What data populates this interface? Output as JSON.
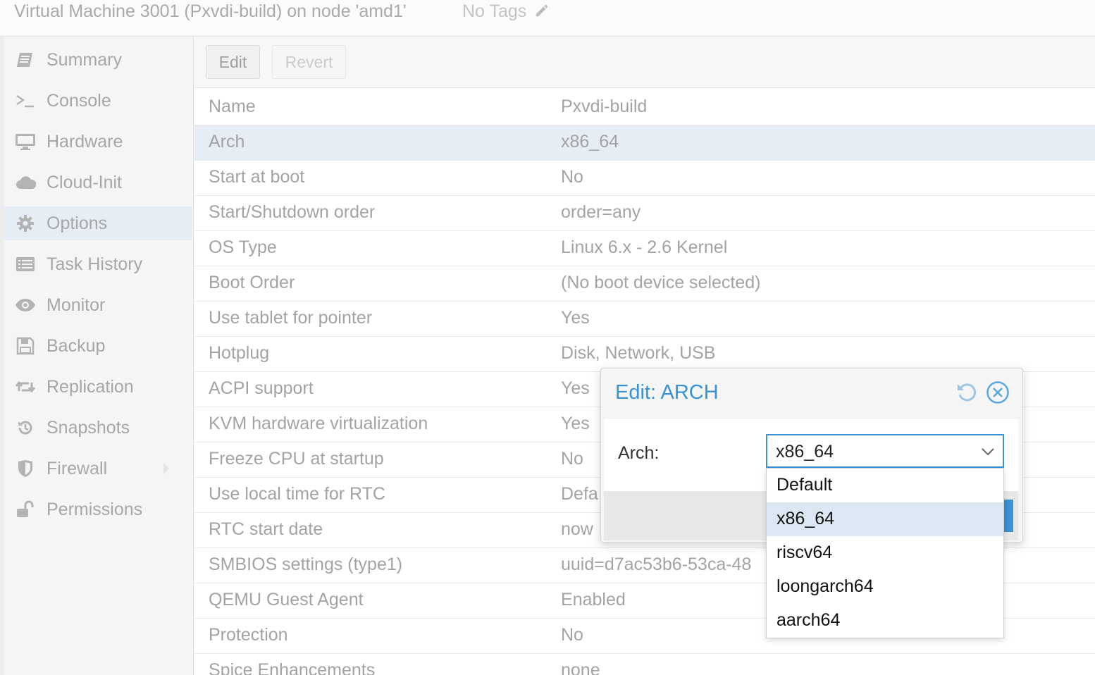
{
  "header": {
    "title": "Virtual Machine 3001 (Pxvdi-build) on node 'amd1'",
    "tags": "No Tags"
  },
  "sidebar": {
    "items": [
      {
        "label": "Summary",
        "icon": "book-icon"
      },
      {
        "label": "Console",
        "icon": "terminal-icon"
      },
      {
        "label": "Hardware",
        "icon": "desktop-icon"
      },
      {
        "label": "Cloud-Init",
        "icon": "cloud-icon"
      },
      {
        "label": "Options",
        "icon": "gear-icon",
        "active": true
      },
      {
        "label": "Task History",
        "icon": "list-icon"
      },
      {
        "label": "Monitor",
        "icon": "eye-icon"
      },
      {
        "label": "Backup",
        "icon": "floppy-icon"
      },
      {
        "label": "Replication",
        "icon": "retweet-icon"
      },
      {
        "label": "Snapshots",
        "icon": "history-icon"
      },
      {
        "label": "Firewall",
        "icon": "shield-icon"
      },
      {
        "label": "Permissions",
        "icon": "unlock-icon"
      }
    ]
  },
  "toolbar": {
    "edit_label": "Edit",
    "revert_label": "Revert"
  },
  "options": {
    "rows": [
      {
        "key": "Name",
        "value": "Pxvdi-build"
      },
      {
        "key": "Arch",
        "value": "x86_64",
        "selected": true
      },
      {
        "key": "Start at boot",
        "value": "No"
      },
      {
        "key": "Start/Shutdown order",
        "value": "order=any"
      },
      {
        "key": "OS Type",
        "value": "Linux 6.x - 2.6 Kernel"
      },
      {
        "key": "Boot Order",
        "value": "(No boot device selected)"
      },
      {
        "key": "Use tablet for pointer",
        "value": "Yes"
      },
      {
        "key": "Hotplug",
        "value": "Disk, Network, USB"
      },
      {
        "key": "ACPI support",
        "value": "Yes"
      },
      {
        "key": "KVM hardware virtualization",
        "value": "Yes"
      },
      {
        "key": "Freeze CPU at startup",
        "value": "No"
      },
      {
        "key": "Use local time for RTC",
        "value": "Defa"
      },
      {
        "key": "RTC start date",
        "value": "now"
      },
      {
        "key": "SMBIOS settings (type1)",
        "value": "uuid=d7ac53b6-53ca-48"
      },
      {
        "key": "QEMU Guest Agent",
        "value": "Enabled"
      },
      {
        "key": "Protection",
        "value": "No"
      },
      {
        "key": "Spice Enhancements",
        "value": "none"
      }
    ]
  },
  "dialog": {
    "title": "Edit: ARCH",
    "field_label": "Arch:",
    "field_value": "x86_64",
    "options": [
      "Default",
      "x86_64",
      "riscv64",
      "loongarch64",
      "aarch64"
    ],
    "highlighted": "x86_64"
  },
  "colors": {
    "accent": "#3892d4",
    "selection": "#e6edf5",
    "dropdown_highlight": "#dbe7f2"
  }
}
